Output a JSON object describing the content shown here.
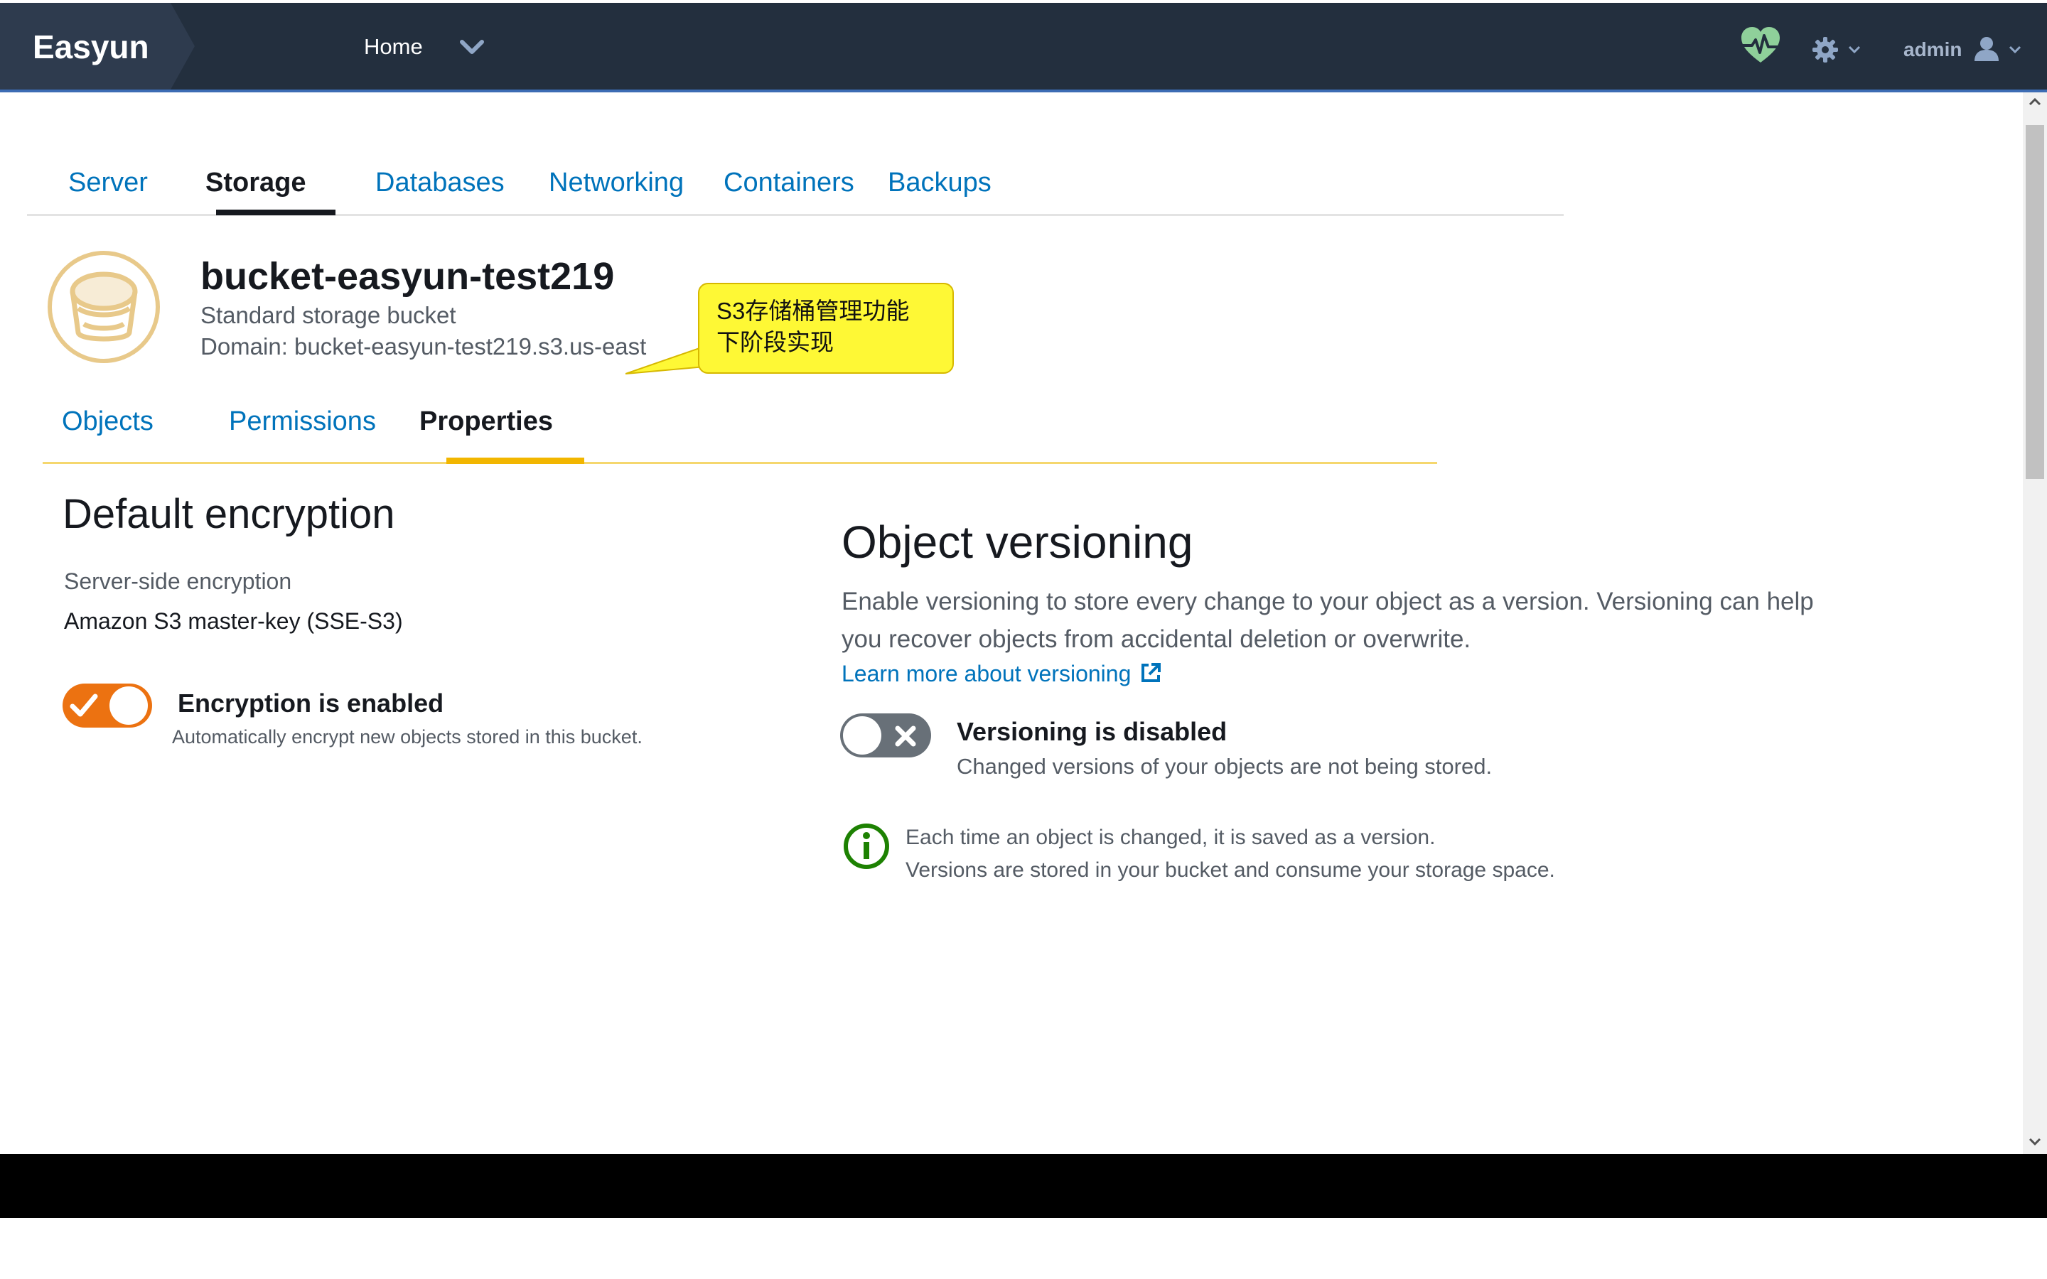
{
  "navbar": {
    "brand": "Easyun",
    "home_label": "Home",
    "user_label": "admin",
    "icons": [
      "chevron-down-icon",
      "health-icon",
      "gear-icon",
      "user-icon"
    ]
  },
  "main_tabs": [
    {
      "label": "Server",
      "active": false
    },
    {
      "label": "Storage",
      "active": true
    },
    {
      "label": "Databases",
      "active": false
    },
    {
      "label": "Networking",
      "active": false
    },
    {
      "label": "Containers",
      "active": false
    },
    {
      "label": "Backups",
      "active": false
    }
  ],
  "bucket": {
    "name": "bucket-easyun-test219",
    "type": "Standard storage bucket",
    "domain": "Domain: bucket-easyun-test219.s3.us-east"
  },
  "callout": {
    "line1": "S3存储桶管理功能",
    "line2": "下阶段实现"
  },
  "sub_tabs": [
    {
      "label": "Objects",
      "active": false
    },
    {
      "label": "Permissions",
      "active": false
    },
    {
      "label": "Properties",
      "active": true
    }
  ],
  "encryption": {
    "title": "Default encryption",
    "label": "Server-side encryption",
    "value": "Amazon S3 master-key (SSE-S3)",
    "enabled": true,
    "status": "Encryption is enabled",
    "description": "Automatically encrypt new objects stored in this bucket."
  },
  "versioning": {
    "title": "Object versioning",
    "description": "Enable versioning to store every change to your object as a version. Versioning can help you recover objects from accidental deletion or overwrite.",
    "learn_more": "Learn more about versioning",
    "enabled": false,
    "status": "Versioning is disabled",
    "status_sub": "Changed versions of your objects are not being stored.",
    "info_line1": "Each time an object is changed, it is saved as a version.",
    "info_line2": "Versions are stored in your bucket and consume your storage space."
  },
  "colors": {
    "navbar_bg": "#232f3e",
    "link": "#0073bb",
    "accent_orange": "#ec7211",
    "tab_underline": "#f2b600",
    "toggle_off": "#687078",
    "info_green": "#1d8102",
    "bucket_icon": "#e8c98a",
    "callout_bg": "#fef835"
  }
}
